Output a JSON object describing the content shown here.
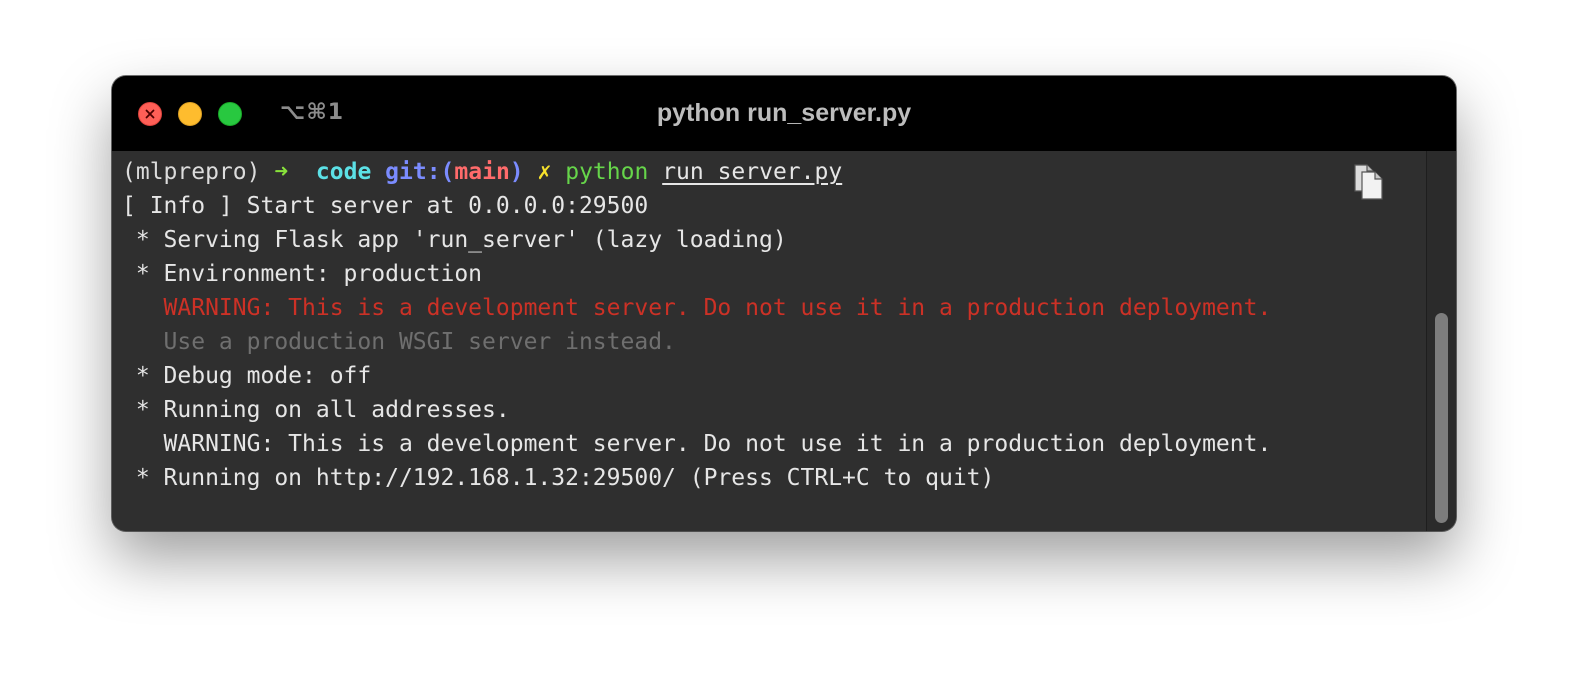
{
  "window": {
    "title": "python run_server.py",
    "shortcut": "⌥⌘1"
  },
  "prompt": {
    "env": "(mlprepro)",
    "arrow": "➜",
    "dir": "code",
    "git_prefix": "git:(",
    "branch": "main",
    "git_suffix": ")",
    "dirty": "✗",
    "command": "python",
    "argument": "run_server.py"
  },
  "output": [
    {
      "text": "[ Info ] Start server at 0.0.0.0:29500",
      "style": "normal"
    },
    {
      "text": " * Serving Flask app 'run_server' (lazy loading)",
      "style": "normal"
    },
    {
      "text": " * Environment: production",
      "style": "normal"
    },
    {
      "text": "   WARNING: This is a development server. Do not use it in a production deployment.",
      "style": "red"
    },
    {
      "text": "   Use a production WSGI server instead.",
      "style": "dim"
    },
    {
      "text": " * Debug mode: off",
      "style": "normal"
    },
    {
      "text": " * Running on all addresses.",
      "style": "normal"
    },
    {
      "text": "   WARNING: This is a development server. Do not use it in a production deployment.",
      "style": "normal"
    },
    {
      "text": " * Running on http://192.168.1.32:29500/ (Press CTRL+C to quit)",
      "style": "normal"
    }
  ],
  "icons": {
    "close": "close-icon",
    "copy": "copy-icon"
  },
  "colors": {
    "titlebar": "#000000",
    "terminal_bg": "#2f2f2f",
    "close": "#fe5f57",
    "minimize": "#febc2e",
    "maximize": "#28c840",
    "warning_red": "#cc3126",
    "prompt_arrow": "#88e23b",
    "prompt_dir": "#5ce1e6",
    "git": "#7b8cff",
    "branch": "#ff6b6b",
    "dirty": "#f6e12c",
    "command": "#66d54a"
  }
}
